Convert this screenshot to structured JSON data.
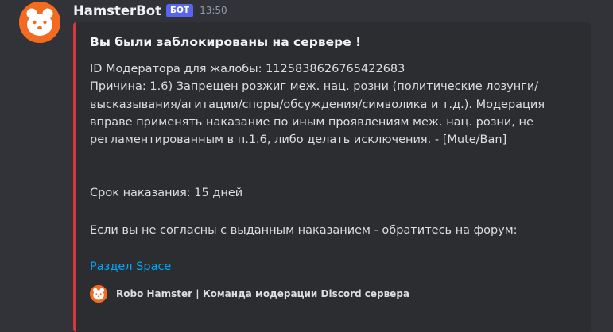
{
  "message": {
    "author": "HamsterBot",
    "bot_tag": "БОТ",
    "timestamp": "13:50"
  },
  "embed": {
    "accent_color": "#da373c",
    "title": "Вы были заблокированы на сервере !",
    "lines": [
      "ID Модератора для жалобы: 1125838626765422683",
      "Причина: 1.6) Запрещен розжиг меж. нац. розни (политические лозунги/",
      "высказывания/агитации/споры/обсуждения/символика и т.д.). Модерация",
      "вправе применять наказание по иным проявлениям меж. нац. розни, не",
      "регламентированным в п.1.6, либо делать исключения. - [Mute/Ban]",
      "Срок наказания: 15 дней",
      "Если вы не согласны с выданным наказанием - обратитесь на форум:"
    ],
    "link_text": "Раздел Space",
    "footer_text": "Robo Hamster | Команда модерации Discord сервера"
  },
  "icons": {
    "avatar": "hamster-avatar-icon",
    "footer": "hamster-footer-icon"
  }
}
